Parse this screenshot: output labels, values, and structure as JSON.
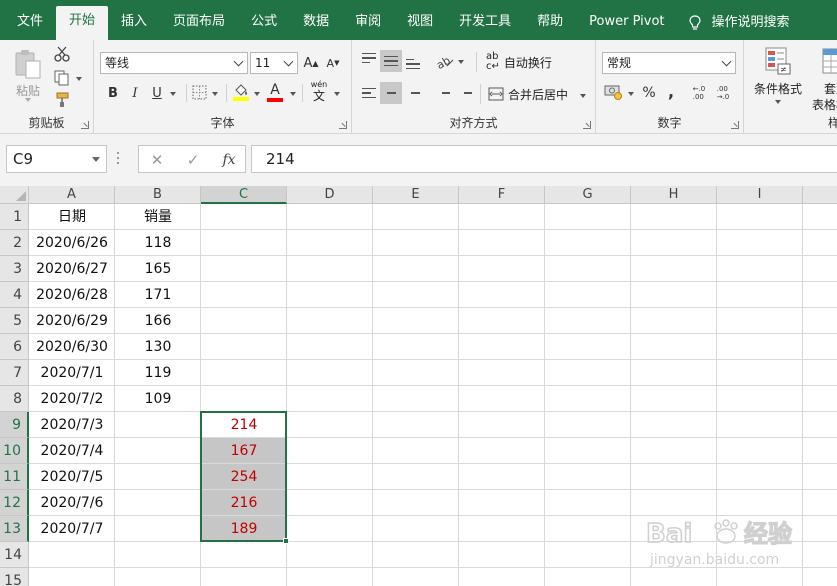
{
  "menu": {
    "items": [
      "文件",
      "开始",
      "插入",
      "页面布局",
      "公式",
      "数据",
      "审阅",
      "视图",
      "开发工具",
      "帮助",
      "Power Pivot"
    ],
    "active_index": 1,
    "tell_me": "操作说明搜索"
  },
  "ribbon": {
    "clipboard": {
      "label": "剪贴板",
      "paste_label": "粘贴"
    },
    "font": {
      "label": "字体",
      "font_name": "等线",
      "font_size": "11",
      "bold": "B",
      "italic": "I",
      "underline": "U",
      "grow": "A",
      "shrink": "A",
      "font_color_glyph": "A",
      "phonetic_glyph": "wén",
      "phonetic_glyph2": "文",
      "highlight_color": "#ffff00",
      "font_color": "#ff0000"
    },
    "alignment": {
      "label": "对齐方式",
      "wrap_text": "自动换行",
      "merge_center": "合并后居中"
    },
    "number": {
      "label": "数字",
      "format": "常规",
      "percent": "%",
      "comma": ","
    },
    "styles": {
      "conditional_format": "条件格式",
      "table_format_partial": "套用",
      "table_format_partial2": "表格格",
      "truncated_label": "样"
    }
  },
  "formula_bar": {
    "name_box": "C9",
    "cancel": "✕",
    "enter": "✓",
    "fx": "fx",
    "value": "214"
  },
  "sheet": {
    "columns": [
      "A",
      "B",
      "C",
      "D",
      "E",
      "F",
      "G",
      "H",
      "I"
    ],
    "selected_column": "C",
    "rows": [
      "1",
      "2",
      "3",
      "4",
      "5",
      "6",
      "7",
      "8",
      "9",
      "10",
      "11",
      "12",
      "13",
      "14",
      "15"
    ],
    "selected_rows": [
      "9",
      "10",
      "11",
      "12",
      "13"
    ],
    "header": {
      "date": "日期",
      "sales": "销量"
    },
    "records": [
      {
        "date": "2020/6/26",
        "sales": "118",
        "c": ""
      },
      {
        "date": "2020/6/27",
        "sales": "165",
        "c": ""
      },
      {
        "date": "2020/6/28",
        "sales": "171",
        "c": ""
      },
      {
        "date": "2020/6/29",
        "sales": "166",
        "c": ""
      },
      {
        "date": "2020/6/30",
        "sales": "130",
        "c": ""
      },
      {
        "date": "2020/7/1",
        "sales": "119",
        "c": ""
      },
      {
        "date": "2020/7/2",
        "sales": "109",
        "c": ""
      },
      {
        "date": "2020/7/3",
        "sales": "",
        "c": "214"
      },
      {
        "date": "2020/7/4",
        "sales": "",
        "c": "167"
      },
      {
        "date": "2020/7/5",
        "sales": "",
        "c": "254"
      },
      {
        "date": "2020/7/6",
        "sales": "",
        "c": "216"
      },
      {
        "date": "2020/7/7",
        "sales": "",
        "c": "189"
      }
    ],
    "forecast_color": "#c00000",
    "accent": "#217346"
  },
  "watermark": {
    "brand": "Bai",
    "brand2": "经验",
    "url": "jingyan.baidu.com"
  }
}
